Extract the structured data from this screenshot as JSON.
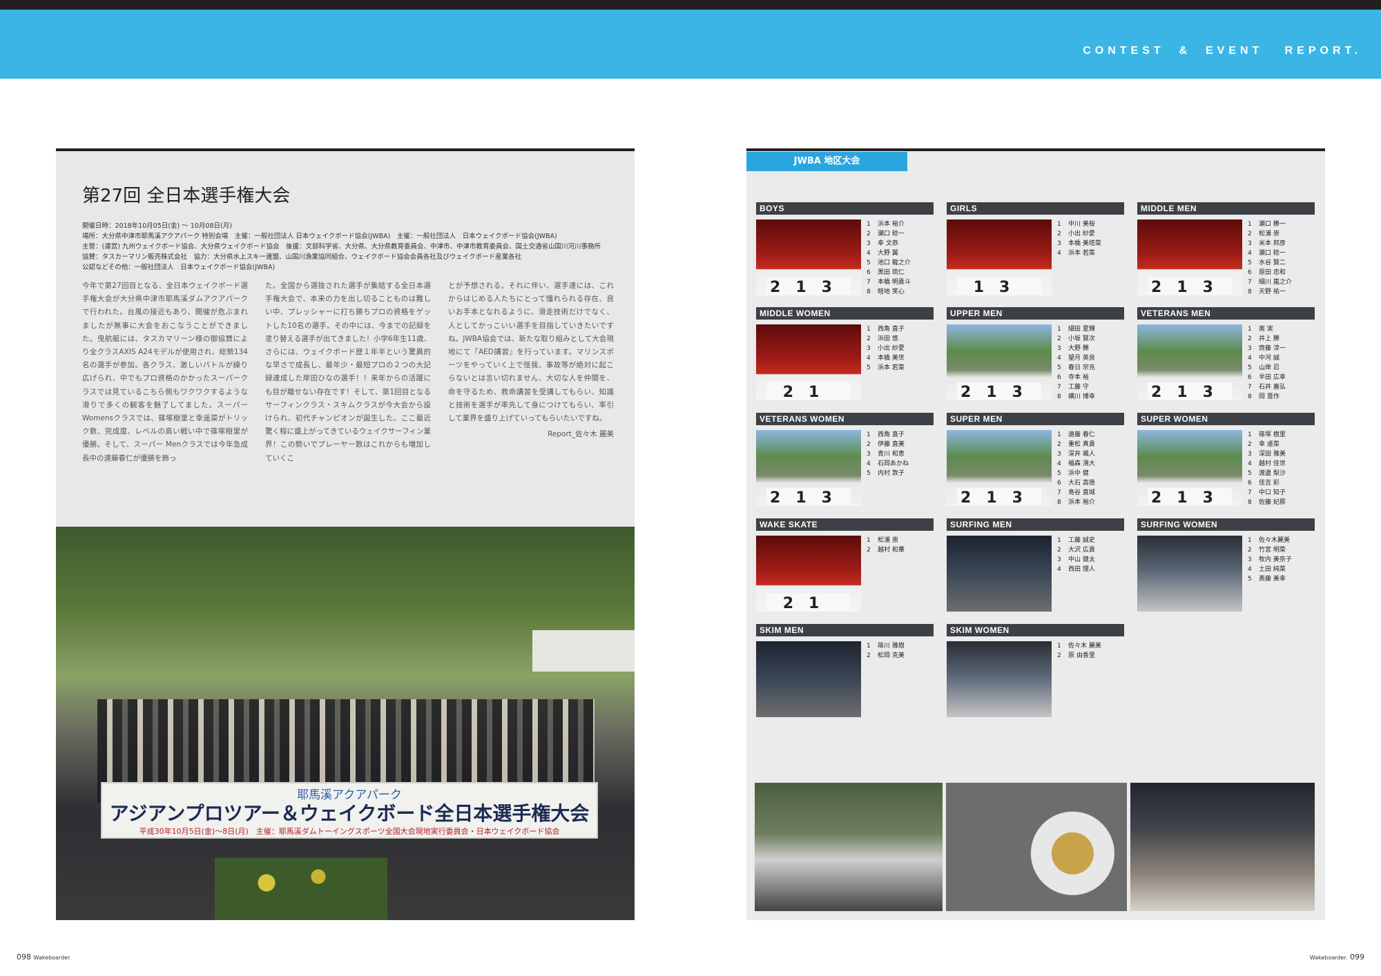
{
  "header": {
    "section_title": "CONTEST  &  EVENT   REPORT."
  },
  "article": {
    "title": "第27回 全日本選手権大会",
    "meta": [
      "開催日時：2018年10月05日(金) 〜 10月08日(月)",
      "場所：大分県中津市耶馬溪アクアパーク 特別会場　主催：一般社団法人 日本ウェイクボード協会(JWBA)　主催：一般社団法人　日本ウェイクボード協会(JWBA)",
      "主管：(運営) 九州ウェイクボード協会、大分県ウェイクボード協会　後援：文部科学省、大分県、大分県教育委員会、中津市、中津市教育委員会、国土交通省山国川河川事務所",
      "協賛：タスカーマリン販売株式会社　協力：大分県水上スキー連盟、山国川漁業協同組合、ウェイクボード協会会員各社及びウェイクボード産業各社",
      "公認などその他：一般社団法人　日本ウェイクボード協会(JWBA)"
    ],
    "columns": [
      "今年で第27回目となる、全日本ウェイクボード選手権大会が大分県中津市耶馬溪ダムアクアパークで行われた。台風の接近もあり、開催が危ぶまれましたが無事に大会をおこなうことができました。曳航艇には、タスカマリーン様の御協賛により全クラスAXIS A24モデルが使用され、総勢134名の選手が参加。各クラス、激しいバトルが繰り広げられ、中でもプロ資格のかかったスーパークラスでは見ているこちら側もワクワクするような滑りで多くの観客を魅了してました。スーパー Womensクラスでは、篠塚樹里と幸遥菜がトリック数、完成度、レベルの高い戦い中で篠塚樹里が優勝。そして、スーパー Menクラスでは今年急成長中の遠藤春仁が優勝を飾っ",
      "た。全国から選抜された選手が集結する全日本選手権大会で、本来の力を出し切ることものは難しい中、プレッシャーに打ち勝ちプロの資格をゲットした10名の選手。その中には、今までの記録を塗り替える選手が出てきました！小学6年生11歳、さらには、ウェイクボード歴１年半という驚異的な早さで成長し、最年少・最短プロの２つの大記録達成した岸田ひなの選手！！来年からの活躍にも目が離せない存在です！そして、第1回目となるサーフィンクラス・スキムクラスが今大会から設けられ、初代チャンピオンが誕生した。ここ最近驚く程に盛上がってきているウェイクサーフィン業界！この勢いでプレーヤー数はこれからも増加していくこ",
      "とが予想される。それに伴い、選手達には、これからはじめる人たちにとって憧れられる存在、良いお手本となれるように、滑走技術だけでなく、人としてかっこいい選手を目指していきたいですね。JWBA協会では、新たな取り組みとして大会現地にて『AED講習』を行っています。マリンスポーツをやっていく上で怪我、事故等が絶対に起こらないとは言い切れません、大切な人を仲間を、命を守るため、救命講習を受講してもらい、知識と技術を選手が率先して身につけてもらい、率引して業界を盛り上げていってもらいたいですね。"
    ],
    "report": "Report_佐々木 麗美"
  },
  "group_photo_sign": {
    "sub": "耶馬溪アクアパーク",
    "main": "アジアンプロツアー＆ウェイクボード全日本選手権大会",
    "date": "平成30年10月5日(金)〜8日(月)　主催：耶馬溪ダムトーイングスポーツ全国大会現地実行委員会・日本ウェイクボード協会"
  },
  "panel": {
    "tab": "JWBA 地区大会",
    "categories": [
      {
        "name": "BOYS",
        "photo": "red",
        "podium": "213",
        "ranks": [
          "浜本 裕介",
          "瀬口 稔一",
          "幸 文恭",
          "大野 翼",
          "池口 龍之介",
          "黒田 琉仁",
          "本橋 明貴斗",
          "畦地 笑心"
        ]
      },
      {
        "name": "GIRLS",
        "photo": "red",
        "podium": " 13",
        "ranks": [
          "中川 美桜",
          "小出 紗愛",
          "本橋 美塔菜",
          "浜本 若菜"
        ]
      },
      {
        "name": "MIDDLE MEN",
        "photo": "red",
        "podium": "213",
        "ranks": [
          "瀬口 勝一",
          "松浦 崇",
          "米本 邦彦",
          "瀬口 稔一",
          "水谷 賢二",
          "原田 忠和",
          "細川 嵐之介",
          "天野 祐一"
        ]
      },
      {
        "name": "MIDDLE WOMEN",
        "photo": "red",
        "podium": "21 ",
        "ranks": [
          "西角 直子",
          "浜田 悠",
          "小出 紗愛",
          "本橋 美世",
          "浜本 若菜"
        ]
      },
      {
        "name": "UPPER MEN",
        "photo": "out",
        "podium": "213",
        "ranks": [
          "細田 夏輝",
          "小坂 賢次",
          "大野 勝",
          "望月 英良",
          "春日 宗充",
          "寺本 裕",
          "工藤 守",
          "横川 博幸"
        ]
      },
      {
        "name": "VETERANS MEN",
        "photo": "out",
        "podium": "213",
        "ranks": [
          "南 実",
          "井上 勝",
          "齊藤 淳一",
          "中河 誠",
          "山岸 忍",
          "半田 広幸",
          "石井 嘉弘",
          "岡 晋作"
        ]
      },
      {
        "name": "VETERANS WOMEN",
        "photo": "out",
        "podium": "213",
        "ranks": [
          "西角 直子",
          "伊藤 直美",
          "青川 和恵",
          "石岡あかね",
          "内村 敦子"
        ]
      },
      {
        "name": "SUPER MEN",
        "photo": "out",
        "podium": "213",
        "ranks": [
          "遠藤 春仁",
          "重松 真貴",
          "深井 颯人",
          "福森 滉大",
          "浜中 健",
          "大石 高徳",
          "島谷 直城",
          "浜本 裕介"
        ]
      },
      {
        "name": "SUPER WOMEN",
        "photo": "out",
        "podium": "213",
        "ranks": [
          "篠塚 樹里",
          "幸 遥菜",
          "深田 雅美",
          "越村 佳世",
          "渡邊 梨沙",
          "佳吉 彩",
          "中口 知子",
          "佐藤 妃那"
        ]
      },
      {
        "name": "WAKE SKATE",
        "photo": "red",
        "podium": "21 ",
        "ranks": [
          "松浦 崇",
          "越村 和華"
        ]
      },
      {
        "name": "SURFING MEN",
        "photo": "night",
        "podium": "",
        "ranks": [
          "工藤 誠史",
          "大沢 広貴",
          "中山 健太",
          "西田 理人"
        ]
      },
      {
        "name": "SURFING WOMEN",
        "photo": "night2",
        "podium": "",
        "ranks": [
          "佐々木麗美",
          "竹宮 明菜",
          "牧内 美奈子",
          "土田 純菜",
          "斎藤 美幸"
        ]
      },
      {
        "name": "SKIM MEN",
        "photo": "night",
        "podium": "",
        "ranks": [
          "篠川 雅樹",
          "松岡 克美"
        ]
      },
      {
        "name": "SKIM WOMEN",
        "photo": "night2",
        "podium": "",
        "ranks": [
          "佐々木 麗美",
          "原 由香里"
        ]
      }
    ]
  },
  "footer": {
    "left_page": "098",
    "left_mag": "Wakeboarder.",
    "right_mag": "Wakeboarder.",
    "right_page": "099"
  }
}
